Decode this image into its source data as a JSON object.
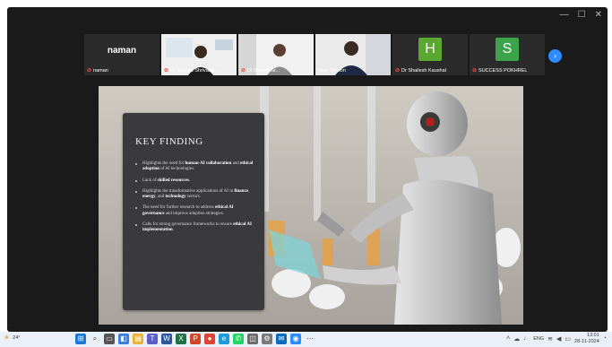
{
  "window": {
    "controls": [
      "—",
      "☐",
      "✕"
    ]
  },
  "participants": [
    {
      "name": "naman",
      "label": "naman",
      "type": "name",
      "muted": true
    },
    {
      "label": "Dr Sushita Shrivasta...",
      "type": "video",
      "muted": true
    },
    {
      "label": "Dr Suman Sr...",
      "type": "video",
      "muted": true
    },
    {
      "label": "Neel Tandon",
      "type": "video",
      "active": true,
      "muted": false
    },
    {
      "letter": "H",
      "label": "Dr Shailesh Kaushal",
      "type": "avatar",
      "color": "#5aa832",
      "muted": true
    },
    {
      "letter": "S",
      "label": "SUCCESS POKHREL",
      "type": "avatar",
      "color": "#3ca34a",
      "muted": true
    }
  ],
  "strip": {
    "next_icon": "›"
  },
  "slide": {
    "title": "KEY FINDING",
    "bullets": [
      {
        "parts": [
          {
            "t": "Highlights the need for "
          },
          {
            "t": "human-AI collaboration",
            "b": true
          },
          {
            "t": " and "
          },
          {
            "t": "ethical adoption",
            "b": true
          },
          {
            "t": " of AI technologies."
          }
        ]
      },
      {
        "parts": [
          {
            "t": "Lack of "
          },
          {
            "t": "skilled resources",
            "b": true
          },
          {
            "t": "."
          }
        ]
      },
      {
        "parts": [
          {
            "t": "Highlights the transformative applications of AI in "
          },
          {
            "t": "finance",
            "b": true
          },
          {
            "t": ", "
          },
          {
            "t": "energy",
            "b": true
          },
          {
            "t": ", and "
          },
          {
            "t": "technology",
            "b": true
          },
          {
            "t": " sectors."
          }
        ]
      },
      {
        "parts": [
          {
            "t": "The need for further research to address "
          },
          {
            "t": "ethical AI governance",
            "b": true
          },
          {
            "t": " and improve adoption strategies."
          }
        ]
      },
      {
        "parts": [
          {
            "t": "Calls for strong governance frameworks to ensure "
          },
          {
            "t": "ethical AI implementation",
            "b": true
          },
          {
            "t": "."
          }
        ]
      }
    ]
  },
  "taskbar": {
    "weather": "24°",
    "tray_lang": "ENG",
    "time": "13:01",
    "date": "28-11-2024"
  }
}
